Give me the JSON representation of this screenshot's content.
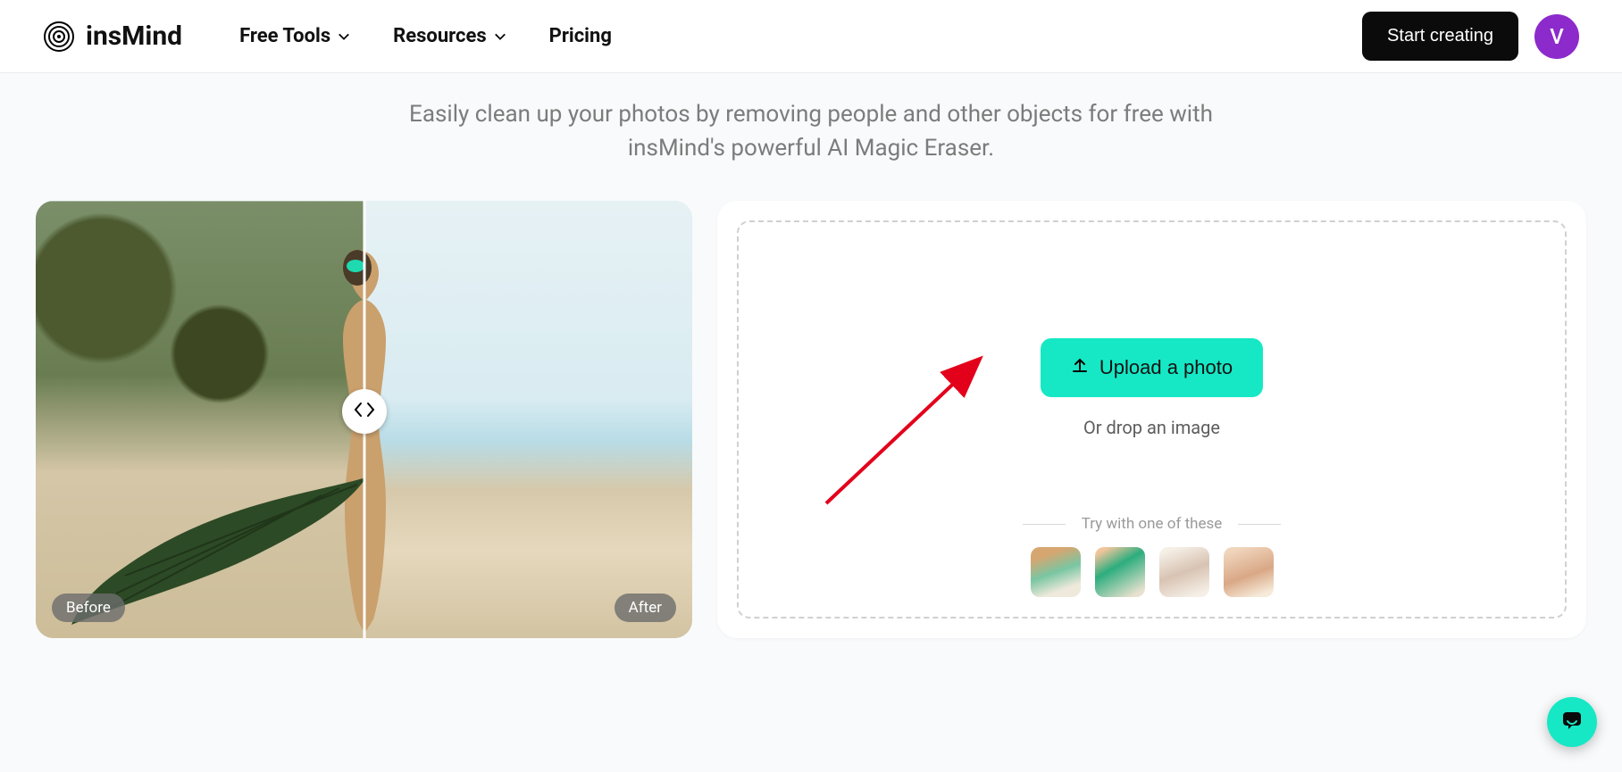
{
  "brand": "insMind",
  "nav": {
    "free_tools": "Free Tools",
    "resources": "Resources",
    "pricing": "Pricing"
  },
  "header": {
    "cta": "Start creating",
    "avatar_initial": "V"
  },
  "hero": {
    "tagline": "Easily clean up your photos by removing people and other objects for free with insMind's powerful AI Magic Eraser."
  },
  "compare": {
    "before": "Before",
    "after": "After"
  },
  "upload": {
    "button": "Upload a photo",
    "drop_text": "Or drop an image",
    "try_label": "Try with one of these"
  }
}
